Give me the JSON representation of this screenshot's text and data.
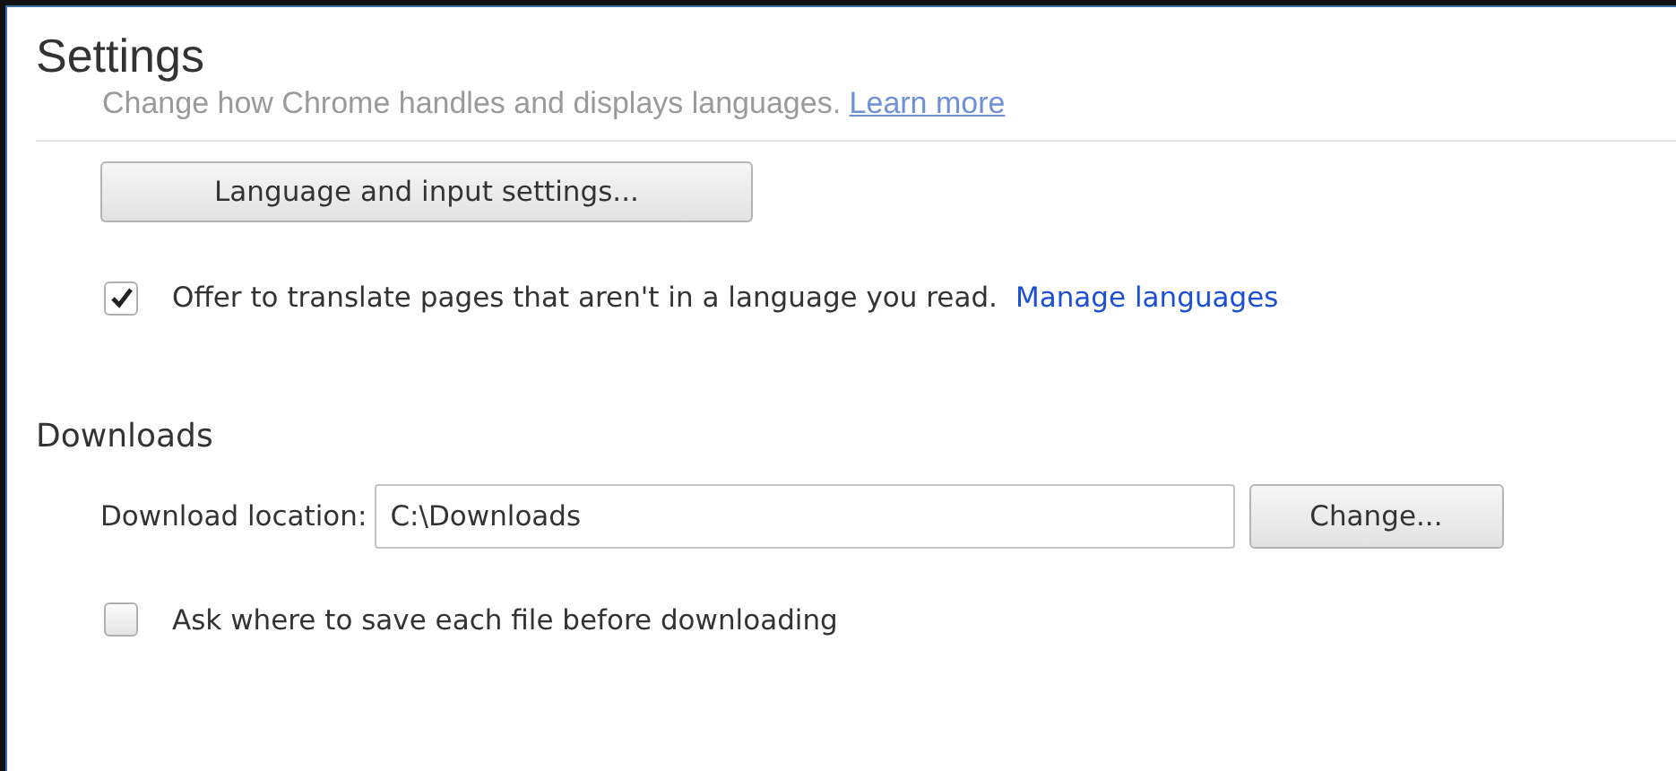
{
  "header": {
    "title": "Settings"
  },
  "languages": {
    "description": "Change how Chrome handles and displays languages.",
    "learn_more": "Learn more",
    "settings_button": "Language and input settings...",
    "translate": {
      "label": "Offer to translate pages that aren't in a language you read.",
      "checked": true,
      "link": "Manage languages"
    }
  },
  "downloads": {
    "heading": "Downloads",
    "location_label": "Download location:",
    "location_value": "C:\\Downloads",
    "change_button": "Change...",
    "ask": {
      "label": "Ask where to save each file before downloading",
      "checked": false
    }
  }
}
